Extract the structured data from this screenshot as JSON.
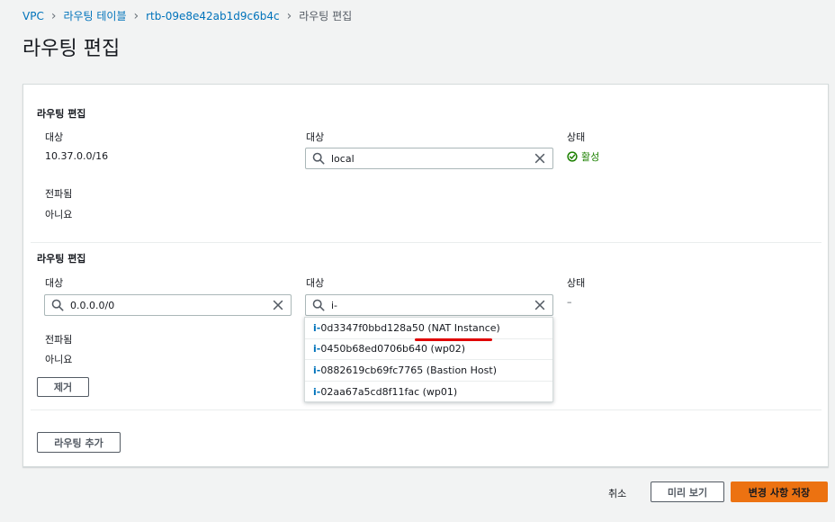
{
  "breadcrumb": {
    "items": [
      "VPC",
      "라우팅 테이블",
      "rtb-09e8e42ab1d9c6b4c"
    ],
    "current": "라우팅 편집"
  },
  "page_title": "라우팅 편집",
  "routes": [
    {
      "section_title": "라우팅 편집",
      "destination_label": "대상",
      "destination_value": "10.37.0.0/16",
      "target_label": "대상",
      "target_value": "local",
      "status_label": "상태",
      "status_value": "활성",
      "propagated_label": "전파됨",
      "propagated_value": "아니요"
    },
    {
      "section_title": "라우팅 편집",
      "destination_label": "대상",
      "destination_value": "0.0.0.0/0",
      "target_label": "대상",
      "target_value": "i-",
      "status_label": "상태",
      "status_value": "–",
      "propagated_label": "전파됨",
      "propagated_value": "아니요",
      "remove_label": "제거"
    }
  ],
  "dropdown": {
    "items": [
      {
        "prefix": "i-",
        "rest": "0d3347f0bbd128a50 (NAT Instance)"
      },
      {
        "prefix": "i-",
        "rest": "0450b68ed0706b640 (wp02)"
      },
      {
        "prefix": "i-",
        "rest": "0882619cb69fc7765 (Bastion Host)"
      },
      {
        "prefix": "i-",
        "rest": "02aa67a5cd8f11fac (wp01)"
      }
    ]
  },
  "add_route_label": "라우팅 추가",
  "footer": {
    "cancel": "취소",
    "preview": "미리 보기",
    "save": "변경 사항 저장"
  },
  "colors": {
    "link": "#0073bb",
    "primary": "#ec7211",
    "success": "#1d8102",
    "annotation": "#e00000"
  }
}
